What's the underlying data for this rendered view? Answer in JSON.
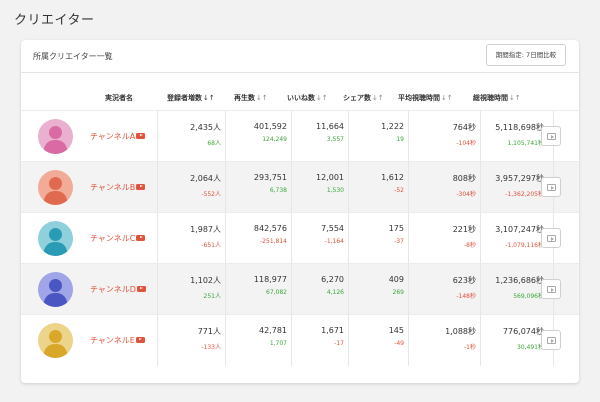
{
  "page": {
    "title": "クリエイター"
  },
  "card": {
    "title": "所属クリエイター一覧",
    "compare_button": "期間指定: 7日間比較"
  },
  "columns": [
    {
      "label": "実況者名",
      "sort": ""
    },
    {
      "label": "登録者増数",
      "sort": "↓↑",
      "active": true
    },
    {
      "label": "再生数",
      "sort": "↓↑"
    },
    {
      "label": "いいね数",
      "sort": "↓↑"
    },
    {
      "label": "シェア数",
      "sort": "↓↑"
    },
    {
      "label": "平均視聴時間",
      "sort": "↓↑"
    },
    {
      "label": "総視聴時間",
      "sort": "↓↑"
    }
  ],
  "colors": {
    "accent": "#e0533d",
    "positive": "#3aa63a",
    "negative": "#e0533d"
  },
  "rows": [
    {
      "channel": "チャンネルA",
      "avatar_color": "#d96aa3",
      "avatar_bg": "#e9b0cf",
      "subs": "2,435人",
      "subs_diff": "68人",
      "subs_sign": "pos",
      "views": "401,592",
      "views_diff": "124,249",
      "views_sign": "pos",
      "likes": "11,664",
      "likes_diff": "3,557",
      "likes_sign": "pos",
      "shares": "1,222",
      "shares_diff": "19",
      "shares_sign": "pos",
      "avg": "764秒",
      "avg_diff": "-104秒",
      "avg_sign": "neg",
      "total": "5,118,698秒",
      "total_diff": "1,105,741秒",
      "total_sign": "pos"
    },
    {
      "channel": "チャンネルB",
      "avatar_color": "#e06a4f",
      "avatar_bg": "#f1ab97",
      "subs": "2,064人",
      "subs_diff": "-552人",
      "subs_sign": "neg",
      "views": "293,751",
      "views_diff": "6,738",
      "views_sign": "pos",
      "likes": "12,001",
      "likes_diff": "1,530",
      "likes_sign": "pos",
      "shares": "1,612",
      "shares_diff": "-52",
      "shares_sign": "neg",
      "avg": "808秒",
      "avg_diff": "-304秒",
      "avg_sign": "neg",
      "total": "3,957,297秒",
      "total_diff": "-1,362,205秒",
      "total_sign": "neg"
    },
    {
      "channel": "チャンネルC",
      "avatar_color": "#2a9bb5",
      "avatar_bg": "#8fd0dc",
      "subs": "1,987人",
      "subs_diff": "-651人",
      "subs_sign": "neg",
      "views": "842,576",
      "views_diff": "-251,814",
      "views_sign": "neg",
      "likes": "7,554",
      "likes_diff": "-1,164",
      "likes_sign": "neg",
      "shares": "175",
      "shares_diff": "-37",
      "shares_sign": "neg",
      "avg": "221秒",
      "avg_diff": "-8秒",
      "avg_sign": "neg",
      "total": "3,107,247秒",
      "total_diff": "-1,079,116秒",
      "total_sign": "neg"
    },
    {
      "channel": "チャンネルD",
      "avatar_color": "#4a56c2",
      "avatar_bg": "#9fa5e6",
      "subs": "1,102人",
      "subs_diff": "251人",
      "subs_sign": "pos",
      "views": "118,977",
      "views_diff": "67,082",
      "views_sign": "pos",
      "likes": "6,270",
      "likes_diff": "4,126",
      "likes_sign": "pos",
      "shares": "409",
      "shares_diff": "269",
      "shares_sign": "pos",
      "avg": "623秒",
      "avg_diff": "-148秒",
      "avg_sign": "neg",
      "total": "1,236,686秒",
      "total_diff": "569,096秒",
      "total_sign": "pos"
    },
    {
      "channel": "チャンネルE",
      "avatar_color": "#d9a72a",
      "avatar_bg": "#ecd58a",
      "subs": "771人",
      "subs_diff": "-133人",
      "subs_sign": "neg",
      "views": "42,781",
      "views_diff": "1,707",
      "views_sign": "pos",
      "likes": "1,671",
      "likes_diff": "-17",
      "likes_sign": "neg",
      "shares": "145",
      "shares_diff": "-49",
      "shares_sign": "neg",
      "avg": "1,088秒",
      "avg_diff": "-1秒",
      "avg_sign": "neg",
      "total": "776,074秒",
      "total_diff": "30,491秒",
      "total_sign": "pos"
    }
  ]
}
